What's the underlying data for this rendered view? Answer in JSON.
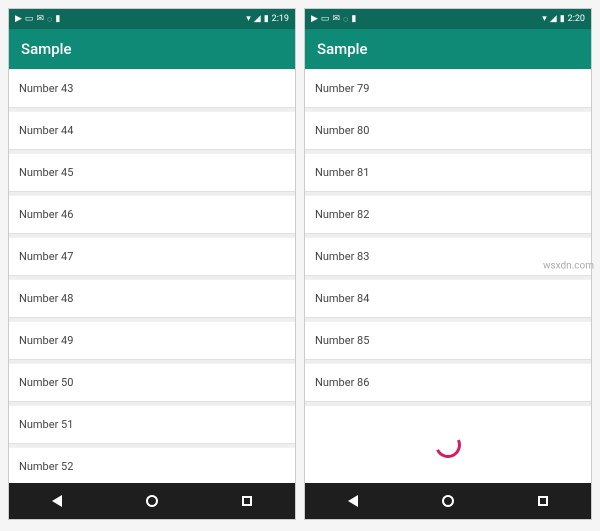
{
  "watermark": "wsxdn.com",
  "phones": [
    {
      "status": {
        "left_icons": [
          "youtube-icon",
          "screencast-icon",
          "mail-icon",
          "sync-icon",
          "card-icon"
        ],
        "right_icons": [
          "wifi-icon",
          "signal-icon",
          "battery-icon"
        ],
        "time": "2:19"
      },
      "app_bar": {
        "title": "Sample"
      },
      "list": {
        "items": [
          {
            "label": "Number 43"
          },
          {
            "label": "Number 44"
          },
          {
            "label": "Number 45"
          },
          {
            "label": "Number 46"
          },
          {
            "label": "Number 47"
          },
          {
            "label": "Number 48"
          },
          {
            "label": "Number 49"
          },
          {
            "label": "Number 50"
          },
          {
            "label": "Number 51"
          },
          {
            "label": "Number 52"
          }
        ],
        "loading": false
      },
      "nav": [
        "back-icon",
        "home-icon",
        "recents-icon"
      ]
    },
    {
      "status": {
        "left_icons": [
          "youtube-icon",
          "screencast-icon",
          "mail-icon",
          "sync-icon",
          "card-icon"
        ],
        "right_icons": [
          "wifi-icon",
          "signal-icon",
          "battery-icon"
        ],
        "time": "2:20"
      },
      "app_bar": {
        "title": "Sample"
      },
      "list": {
        "items": [
          {
            "label": "Number 79"
          },
          {
            "label": "Number 80"
          },
          {
            "label": "Number 81"
          },
          {
            "label": "Number 82"
          },
          {
            "label": "Number 83"
          },
          {
            "label": "Number 84"
          },
          {
            "label": "Number 85"
          },
          {
            "label": "Number 86"
          }
        ],
        "loading": true
      },
      "nav": [
        "back-icon",
        "home-icon",
        "recents-icon"
      ]
    }
  ]
}
